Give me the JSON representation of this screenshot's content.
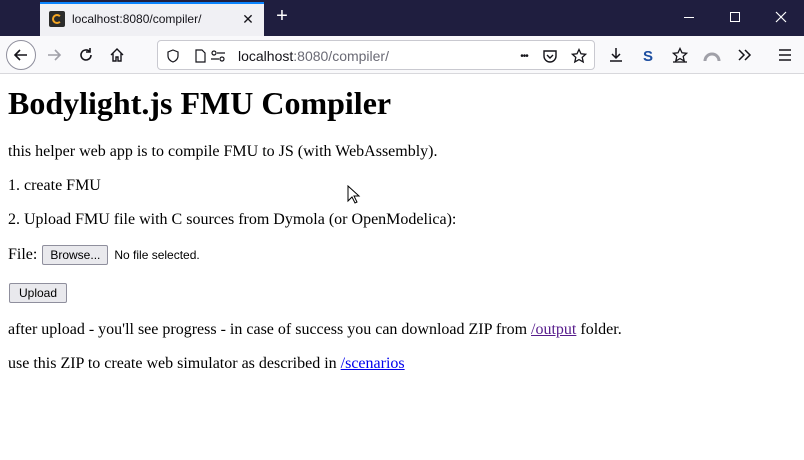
{
  "browser": {
    "tab": {
      "title": "localhost:8080/compiler/",
      "close_glyph": "✕"
    },
    "new_tab_glyph": "+",
    "url": {
      "host": "localhost",
      "rest": ":8080/compiler/"
    },
    "menu_dots": "•••"
  },
  "page": {
    "heading": "Bodylight.js FMU Compiler",
    "intro": "this helper web app is to compile FMU to JS (with WebAssembly).",
    "step1": "1. create FMU",
    "step2": "2. Upload FMU file with C sources from Dymola (or OpenModelica):",
    "file_label": "File:",
    "browse_label": "Browse...",
    "no_file": "No file selected.",
    "upload_label": "Upload",
    "after_upload_before": "after upload - you'll see progress - in case of success you can download ZIP from ",
    "after_upload_link": "/output",
    "after_upload_after": " folder.",
    "use_zip_before": "use this ZIP to create web simulator as described in ",
    "use_zip_link": "/scenarios"
  },
  "colors": {
    "titlebar": "#1f1e3f",
    "tab_accent": "#0a84ff",
    "link": "#0000ee",
    "visited_link": "#551a8b"
  }
}
